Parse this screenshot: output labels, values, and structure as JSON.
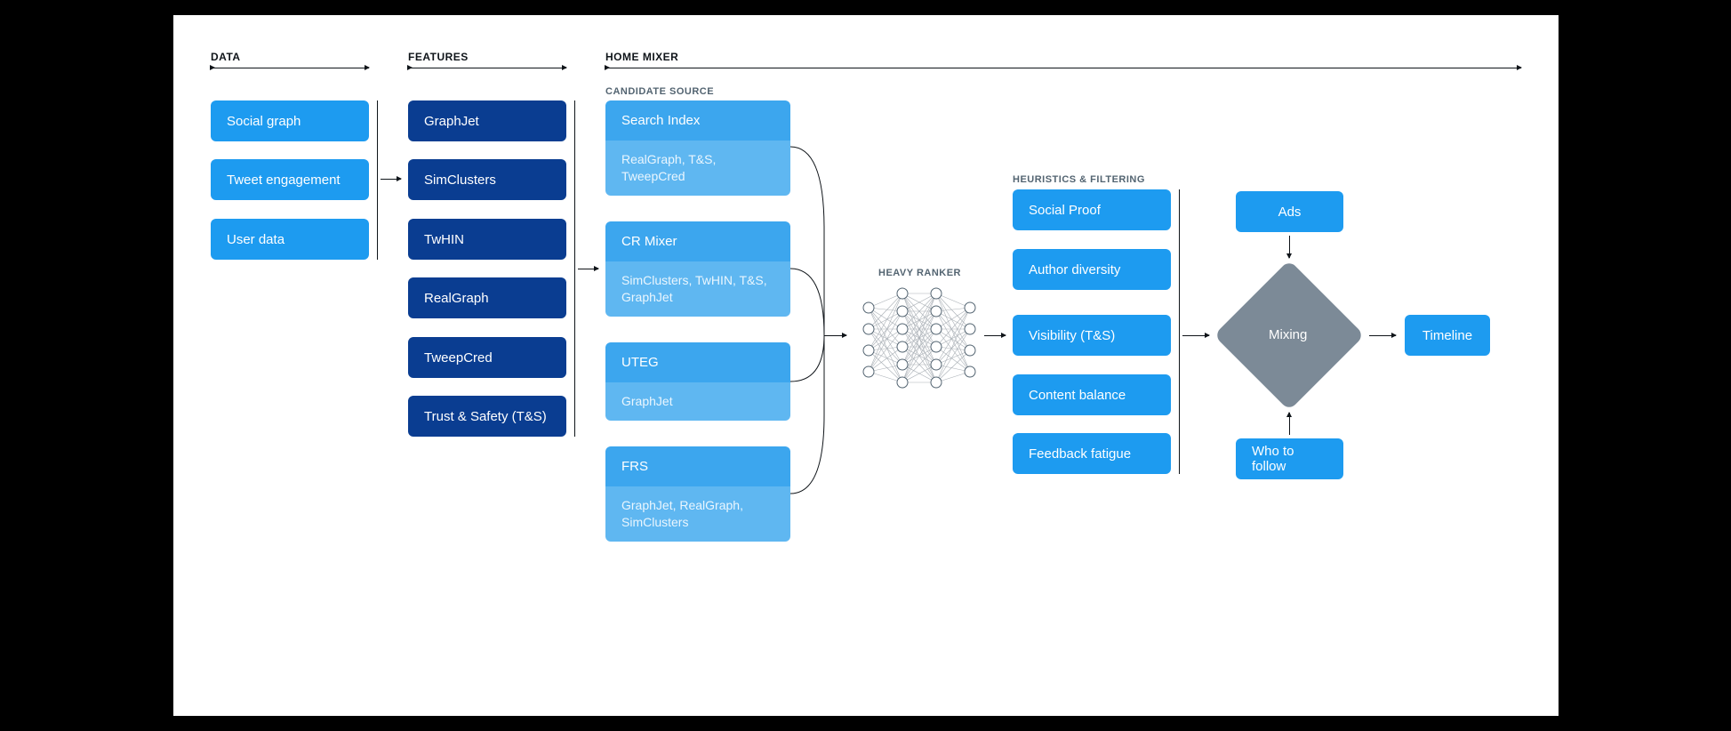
{
  "sections": {
    "data": "DATA",
    "features": "FEATURES",
    "home_mixer": "HOME MIXER",
    "candidate_source": "CANDIDATE SOURCE",
    "heavy_ranker": "HEAVY RANKER",
    "heuristics": "HEURISTICS & FILTERING"
  },
  "data_col": [
    "Social graph",
    "Tweet engagement",
    "User data"
  ],
  "features_col": [
    "GraphJet",
    "SimClusters",
    "TwHIN",
    "RealGraph",
    "TweepCred",
    "Trust & Safety (T&S)"
  ],
  "candidates": [
    {
      "name": "Search Index",
      "sub": "RealGraph, T&S, TweepCred"
    },
    {
      "name": "CR Mixer",
      "sub": "SimClusters, TwHIN, T&S, GraphJet"
    },
    {
      "name": "UTEG",
      "sub": "GraphJet"
    },
    {
      "name": "FRS",
      "sub": "GraphJet, RealGraph, SimClusters"
    }
  ],
  "heuristics_col": [
    "Social Proof",
    "Author diversity",
    "Visibility (T&S)",
    "Content balance",
    "Feedback fatigue"
  ],
  "mixing": {
    "label": "Mixing",
    "top": "Ads",
    "bottom": "Who to follow"
  },
  "timeline": "Timeline"
}
